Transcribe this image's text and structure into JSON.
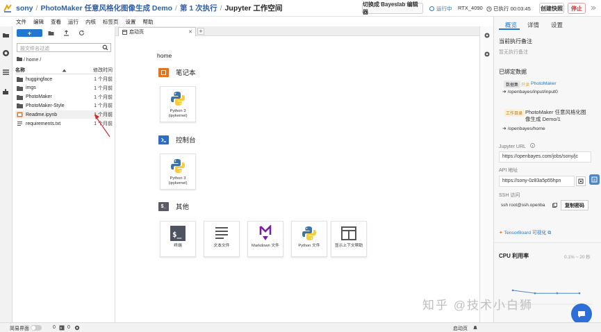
{
  "header": {
    "breadcrumb": [
      "sony",
      "PhotoMaker 任意风格化图像生成 Demo",
      "第 1 次执行",
      "Jupyter 工作空间"
    ],
    "switch_editor_label": "切换成 Bayeslab 编辑器",
    "running_label": "运行中",
    "gpu_label": "RTX_4090",
    "elapsed_label": "已执行 00:03:45",
    "snapshot_label": "创建快照",
    "stop_label": "停止",
    "brand_color": "#1f77d0",
    "stop_color": "#d93030"
  },
  "menu": [
    "文件",
    "编辑",
    "查看",
    "运行",
    "内核",
    "标签页",
    "设置",
    "帮助"
  ],
  "filebrowser": {
    "new_label": "+",
    "search_placeholder": "按文件名过滤",
    "path": "/ home /",
    "col_name": "名称",
    "col_modified": "修改时间",
    "files": [
      {
        "name": "huggingface",
        "modified": "1 个月前",
        "type": "folder"
      },
      {
        "name": "imgs",
        "modified": "1 个月前",
        "type": "folder"
      },
      {
        "name": "PhotoMaker",
        "modified": "1 个月前",
        "type": "folder"
      },
      {
        "name": "PhotoMaker-Style",
        "modified": "1 个月前",
        "type": "folder"
      },
      {
        "name": "Readme.ipynb",
        "modified": "1 个月前",
        "type": "notebook"
      },
      {
        "name": "requirements.txt",
        "modified": "1 个月前",
        "type": "text"
      }
    ]
  },
  "launcher": {
    "tab_label": "启动页",
    "home_label": "home",
    "notebook_section": "笔记本",
    "console_section": "控制台",
    "other_section": "其他",
    "notebook_card": "Python 3 (ipykernel)",
    "console_card": "Python 3 (ipykernel)",
    "other_cards": [
      "终端",
      "文本文件",
      "Markdown 文件",
      "Python 文件",
      "显示上下文帮助"
    ]
  },
  "right_panel": {
    "tabs": [
      "概览",
      "详情",
      "设置"
    ],
    "note_title": "当前执行备注",
    "note_empty": "暂无执行备注",
    "data_title": "已绑定数据",
    "dataset_chip": "数据集",
    "dataset_tag": "只读",
    "dataset_name": "PhotoMaker",
    "dataset_path": "/openbayes/input/input0",
    "workdir_chip": "工作目录",
    "workdir_name": "PhotoMaker 任意风格化图像生成 Demo/1",
    "workdir_path": "/openbayes/home",
    "jupyter_url_label": "Jupyter URL",
    "jupyter_url": "https://openbayes.com/jobs/sony/jc",
    "api_label": "API 地址",
    "api_url": "https://sony-0z83a5p55hpn",
    "ssh_label": "SSH 访问",
    "ssh_cmd": "ssh root@ssh.openba",
    "copy_label": "复制密码",
    "tensorboard_label": "TensorBoard 可视化",
    "cpu_label": "CPU 利用率",
    "cpu_range": "0.1% ~ 20 秒",
    "cpu_values": [
      0.35,
      0.28,
      0.28,
      0.28
    ]
  },
  "statusbar": {
    "simple_label": "简易界面",
    "count1": "0",
    "count2": "0",
    "right_label": "启动页"
  },
  "watermark": "知乎 @技术小白狮"
}
